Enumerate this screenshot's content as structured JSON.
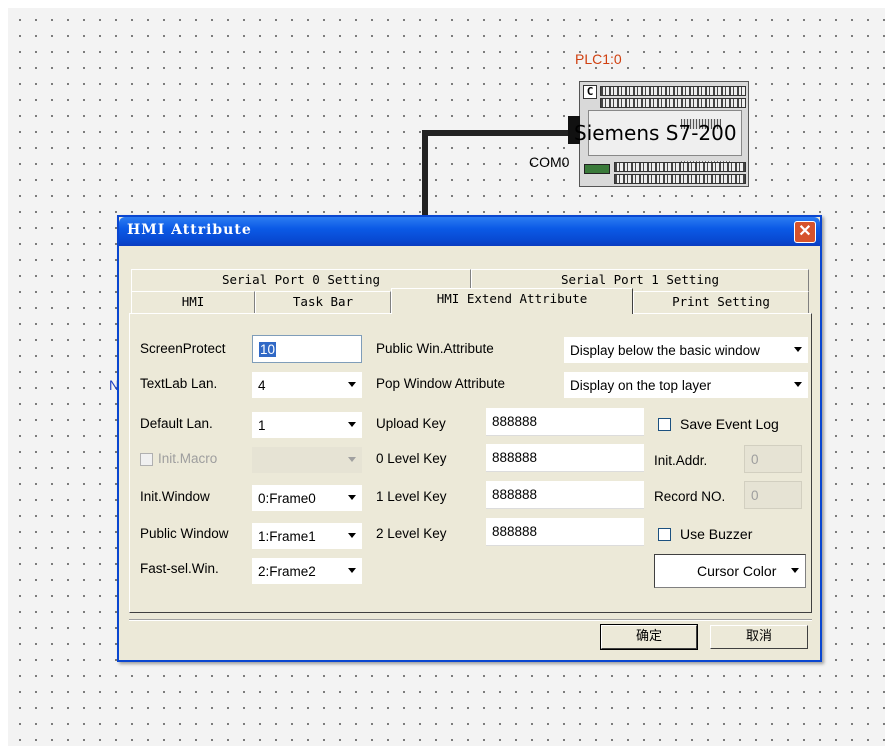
{
  "diagram": {
    "plc_label": "PLC1:0",
    "plc_name": "Siemens S7-200",
    "com_port": "COM0",
    "partial_label": "Ne",
    "plc_c_icon": "C"
  },
  "dialog": {
    "title": "HMI Attribute",
    "close_glyph": "✕",
    "tabs_row1": [
      "Serial Port 0 Setting",
      "Serial Port 1 Setting"
    ],
    "tabs_row2": [
      "HMI",
      "Task Bar",
      "HMI Extend Attribute",
      "Print Setting"
    ],
    "active_tab": "HMI Extend Attribute",
    "labels": {
      "screen_protect": "ScreenProtect",
      "textlab_lan": "TextLab Lan.",
      "default_lan": "Default Lan.",
      "init_macro": "Init.Macro",
      "init_window": "Init.Window",
      "public_window": "Public Window",
      "fast_sel_win": "Fast-sel.Win.",
      "public_win_attribute": "Public Win.Attribute",
      "pop_window_attribute": "Pop Window Attribute",
      "upload_key": "Upload Key",
      "level0_key": "0 Level Key",
      "level1_key": "1 Level Key",
      "level2_key": "2 Level Key",
      "save_event_log": "Save Event Log",
      "init_addr": "Init.Addr.",
      "record_no": "Record NO.",
      "use_buzzer": "Use Buzzer",
      "cursor_color": "Cursor Color"
    },
    "values": {
      "screen_protect": "10",
      "textlab_lan": "4",
      "default_lan": "1",
      "init_macro": "",
      "init_window": "0:Frame0",
      "public_window": "1:Frame1",
      "fast_sel_win": "2:Frame2",
      "public_win_attribute": "Display below the basic window",
      "pop_window_attribute": "Display on the top layer",
      "upload_key": "888888",
      "level0_key": "888888",
      "level1_key": "888888",
      "level2_key": "888888",
      "init_addr": "0",
      "record_no": "0"
    },
    "checkboxes": {
      "init_macro": false,
      "save_event_log": false,
      "use_buzzer": false
    },
    "buttons": {
      "ok": "确定",
      "cancel": "取消"
    },
    "colors": {
      "title_bar": "#0b5ae6",
      "dialog_bg": "#ece9d8",
      "close": "#d6532c",
      "plc_label": "#d04010"
    }
  }
}
